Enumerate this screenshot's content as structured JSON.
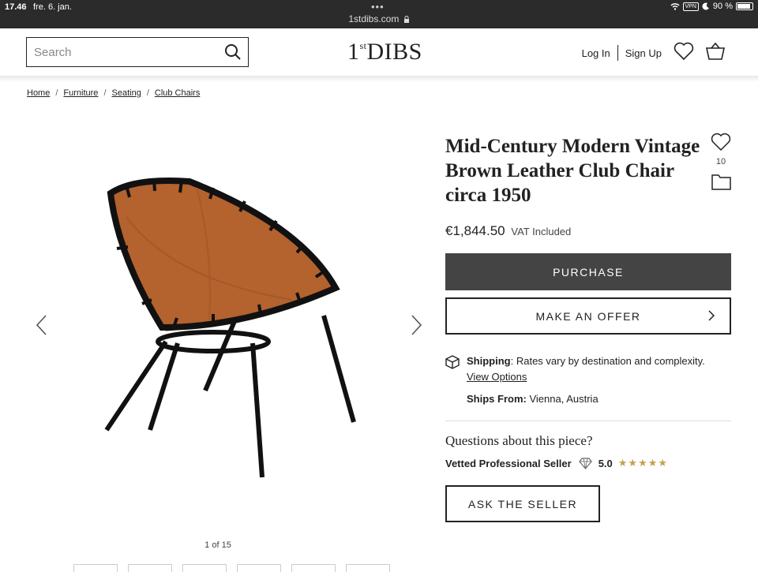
{
  "status_bar": {
    "time": "17.46",
    "date": "fre. 6. jan.",
    "url": "1stdibs.com",
    "vpn": "VPN",
    "battery": "90 %"
  },
  "header": {
    "search_placeholder": "Search",
    "logo_prefix": "1",
    "logo_super": "st",
    "logo_main": "DIBS",
    "login": "Log In",
    "signup": "Sign Up"
  },
  "breadcrumb": [
    "Home",
    "Furniture",
    "Seating",
    "Club Chairs"
  ],
  "gallery": {
    "counter": "1 of 15"
  },
  "product": {
    "title": "Mid-Century Modern Vintage Brown Leather Club Chair circa 1950",
    "favorites_count": "10",
    "price": "€1,844.50",
    "vat": "VAT Included",
    "purchase_label": "PURCHASE",
    "offer_label": "MAKE AN OFFER"
  },
  "shipping": {
    "label": "Shipping",
    "text": ": Rates vary by destination and complexity.",
    "view_options": "View Options",
    "ships_from_label": "Ships From:",
    "ships_from_value": "Vienna, Austria"
  },
  "seller": {
    "questions": "Questions about this piece?",
    "vetted": "Vetted Professional Seller",
    "rating": "5.0",
    "stars": "★★★★★",
    "rating_stars": 5,
    "ask_label": "ASK THE SELLER"
  },
  "colors": {
    "status_bar_bg": "#2b2b2b",
    "purchase_bg": "#444444",
    "star": "#c2a24c",
    "leather": "#b4622e"
  }
}
